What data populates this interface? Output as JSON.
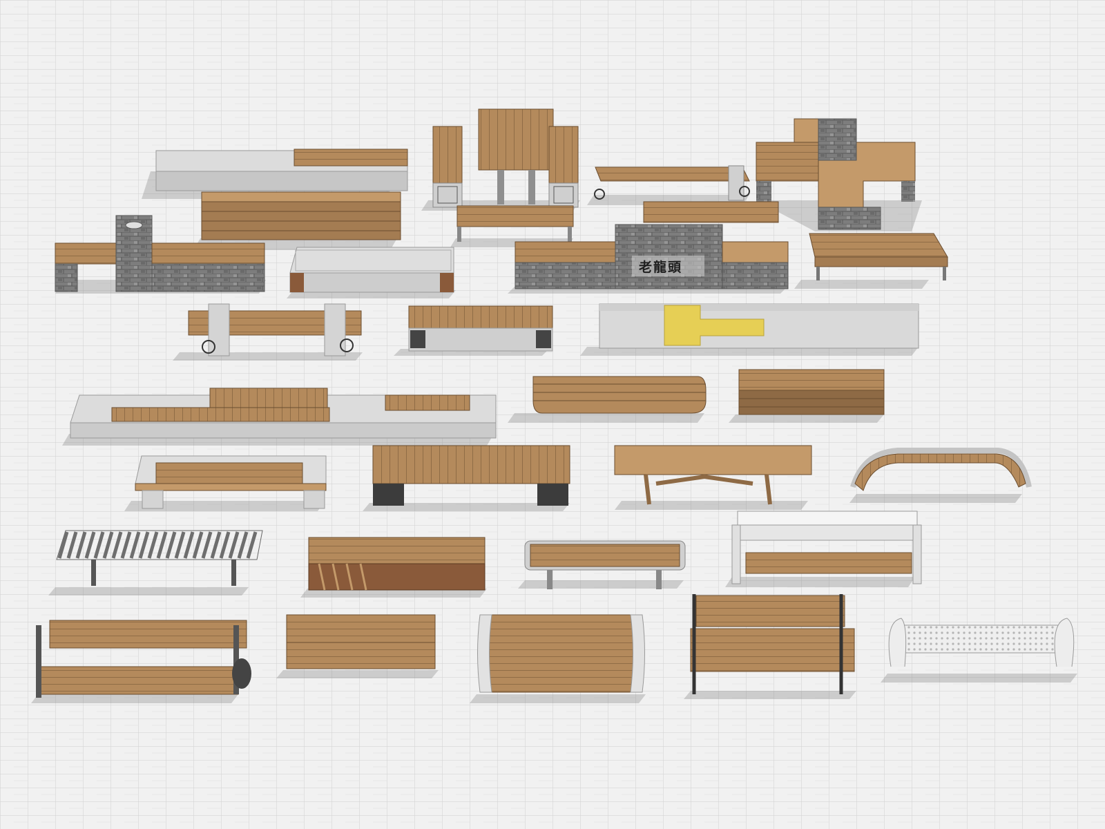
{
  "scene": {
    "kind": "3D model catalogue of outdoor park benches on a paved plaza",
    "colors": {
      "ground": "#f1f1f1",
      "tile_line": "#cfcfcf",
      "wood": "#b48a5c",
      "wood_light": "#c49a6a",
      "wood_dark": "#7b5a3a",
      "wood_line": "#6a4d30",
      "granite": "#d9d9d9",
      "granite_dark": "#bdbdbd",
      "stone": "#8a8a8a",
      "stone_dark": "#5c5c5c",
      "metal": "#6e6e6e",
      "metal_light": "#e8e8e8",
      "accent_yellow": "#e6cf55",
      "rust": "#8a5a3a",
      "shadow": "rgba(120,120,120,0.35)"
    }
  },
  "sign": {
    "text": "老龍頭"
  }
}
